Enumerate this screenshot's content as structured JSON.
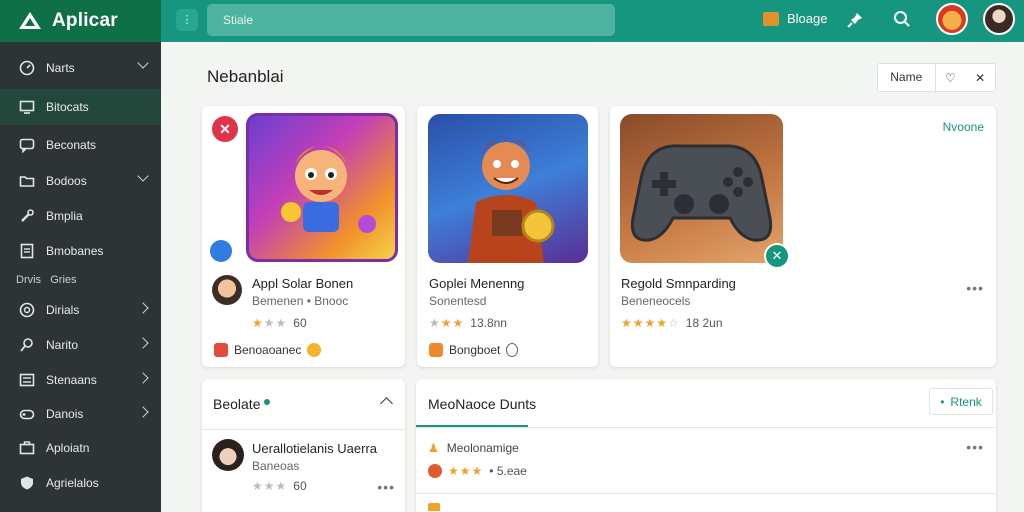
{
  "app": {
    "name": "Aplicar"
  },
  "search": {
    "placeholder": "Stiale"
  },
  "header": {
    "messages_label": "Bloage"
  },
  "sidebar": {
    "items": [
      {
        "label": "Narts",
        "icon": "gauge-icon"
      },
      {
        "label": "Bitocats",
        "icon": "monitor-icon"
      },
      {
        "label": "Beconats",
        "icon": "chat-icon"
      },
      {
        "label": "Bodoos",
        "icon": "folder-icon"
      },
      {
        "label": "Bmplia",
        "icon": "wrench-icon"
      },
      {
        "label": "Bmobanes",
        "icon": "document-icon"
      },
      {
        "label": "Dirials",
        "icon": "globe-icon"
      },
      {
        "label": "Narito",
        "icon": "pin-icon"
      },
      {
        "label": "Stenaans",
        "icon": "list-icon"
      },
      {
        "label": "Danois",
        "icon": "gamepad-icon"
      },
      {
        "label": "Aploiatn",
        "icon": "briefcase-icon"
      },
      {
        "label": "Agrielalos",
        "icon": "shield-icon"
      }
    ],
    "section_prefix": "Drvis",
    "section_label": "Gries"
  },
  "main": {
    "title": "Nebanblai",
    "name_button": "Name",
    "featured_label": "Nvoone",
    "cards": [
      {
        "title": "Appl Solar Bonen",
        "subtitle": "Bemenen • Bnooc",
        "rating": 3,
        "rating_text": "60",
        "tag": "Benoaoanec"
      },
      {
        "title": "Goplei Menenng",
        "subtitle": "Sonentesd",
        "rating": 3,
        "rating_text": "13.8nn",
        "tag": "Bongboet"
      },
      {
        "title": "Regold Smnparding",
        "subtitle": "Beneneocels",
        "rating": 4,
        "rating_text": "18 2un",
        "tag": ""
      }
    ],
    "panel_left": {
      "title": "Beolate",
      "item": {
        "title": "Uerallotielanis Uaerra",
        "subtitle": "Baneoas",
        "rating": 3,
        "rating_text": "60"
      }
    },
    "panel_right": {
      "title": "MeoNaoce Dunts",
      "button": "Rtenk",
      "item": {
        "title": "Meolonamige",
        "rating": 3,
        "rating_text": "• 5.eae"
      }
    }
  },
  "colors": {
    "topbar": "#16957f",
    "brand": "#0f6f47",
    "sidebar": "#2e3436",
    "accent": "#16957f",
    "star": "#f1a229"
  }
}
